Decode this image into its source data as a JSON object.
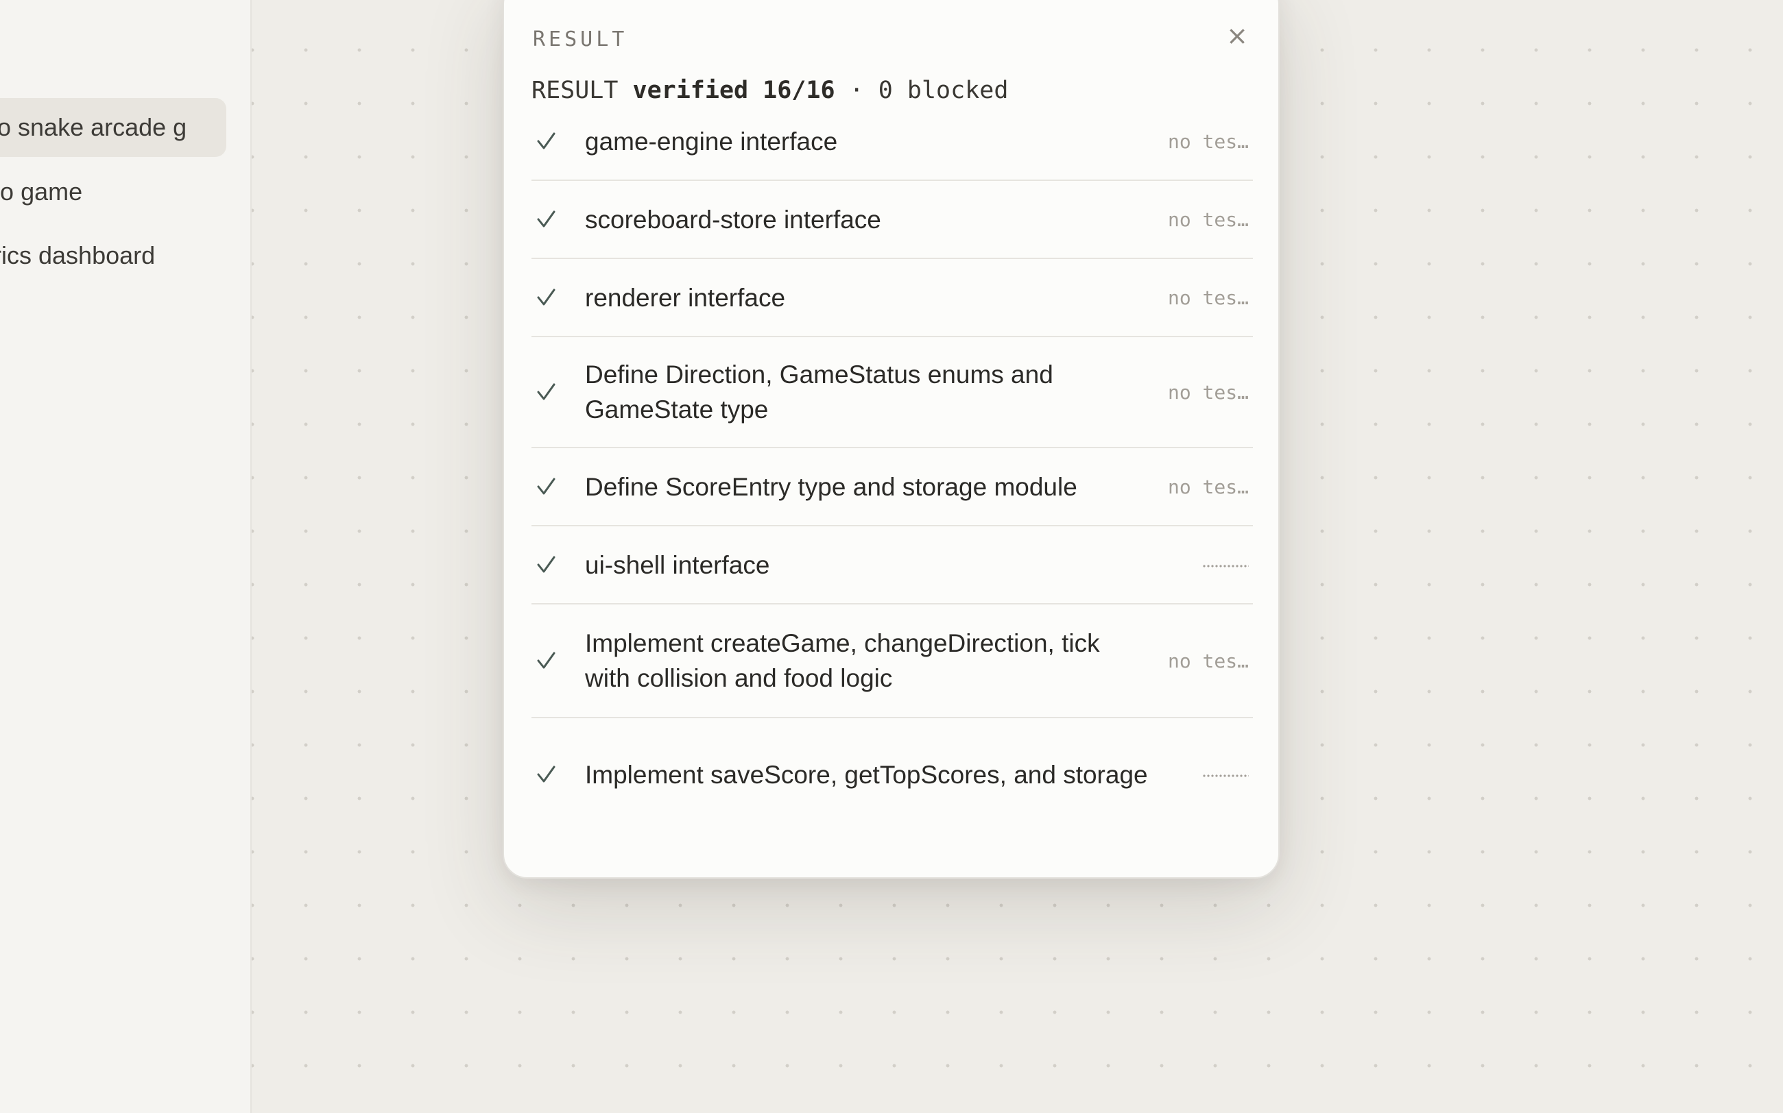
{
  "sidebar": {
    "items": [
      {
        "label": "o snake arcade g…",
        "active": true
      },
      {
        "label": "deo game",
        "active": false
      },
      {
        "label": "etrics dashboard",
        "active": false
      }
    ]
  },
  "modal": {
    "header_label": "RESULT",
    "close_label": "×",
    "summary": {
      "prefix": "RESULT",
      "verified": "verified 16/16",
      "separator": "·",
      "blocked": "0 blocked"
    },
    "tasks": [
      {
        "title": "game-engine interface",
        "status": "no tes…",
        "status_type": "text"
      },
      {
        "title": "scoreboard-store interface",
        "status": "no tes…",
        "status_type": "text"
      },
      {
        "title": "renderer interface",
        "status": "no tes…",
        "status_type": "text"
      },
      {
        "title": "Define Direction, GameStatus enums and GameState type",
        "status": "no tes…",
        "status_type": "text"
      },
      {
        "title": "Define ScoreEntry type and storage module",
        "status": "no tes…",
        "status_type": "text"
      },
      {
        "title": "ui-shell interface",
        "status": "",
        "status_type": "dots"
      },
      {
        "title": "Implement createGame, changeDirection, tick with collision and food logic",
        "status": "no tes…",
        "status_type": "text"
      },
      {
        "title": "Implement saveScore, getTopScores, and storage",
        "status": "",
        "status_type": "dots"
      }
    ]
  },
  "colors": {
    "canvas_bg": "#efede8",
    "sidebar_bg": "#f5f4f1",
    "modal_bg": "#fcfcfa",
    "check": "#4a5a54",
    "muted_text": "#a29e97"
  },
  "icons": {
    "check": "check-icon",
    "close": "close-icon"
  }
}
